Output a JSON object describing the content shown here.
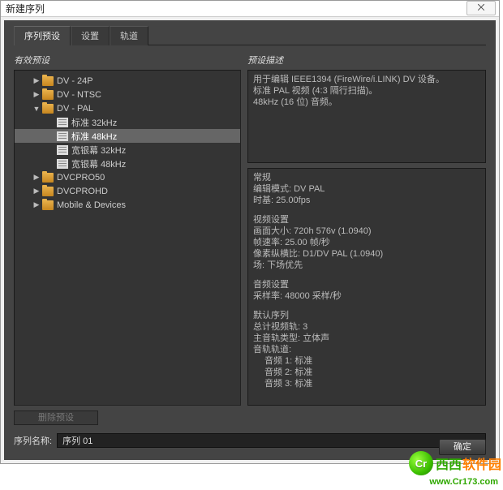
{
  "window": {
    "title": "新建序列",
    "close_glyph": "⨉"
  },
  "tabs": [
    "序列预设",
    "设置",
    "轨道"
  ],
  "active_tab_index": 0,
  "left": {
    "heading": "有效预设",
    "delete_label": "删除预设"
  },
  "tree": [
    {
      "name": "DV - 24P",
      "type": "folder",
      "indent": 1,
      "expanded": false
    },
    {
      "name": "DV - NTSC",
      "type": "folder",
      "indent": 1,
      "expanded": false
    },
    {
      "name": "DV - PAL",
      "type": "folder",
      "indent": 1,
      "expanded": true
    },
    {
      "name": "标准 32kHz",
      "type": "preset",
      "indent": 2
    },
    {
      "name": "标准 48kHz",
      "type": "preset",
      "indent": 2,
      "selected": true
    },
    {
      "name": "宽银幕 32kHz",
      "type": "preset",
      "indent": 2
    },
    {
      "name": "宽银幕 48kHz",
      "type": "preset",
      "indent": 2
    },
    {
      "name": "DVCPRO50",
      "type": "folder",
      "indent": 1,
      "expanded": false
    },
    {
      "name": "DVCPROHD",
      "type": "folder",
      "indent": 1,
      "expanded": false
    },
    {
      "name": "Mobile & Devices",
      "type": "folder",
      "indent": 1,
      "expanded": false
    }
  ],
  "right": {
    "heading": "预设描述",
    "desc": [
      "用于编辑 IEEE1394 (FireWire/i.LINK) DV 设备。",
      "标准 PAL 视频 (4:3 隔行扫描)。",
      "48kHz (16 位) 音频。"
    ],
    "spec": {
      "general_h": "常规",
      "general": [
        "编辑模式: DV PAL",
        "时基: 25.00fps"
      ],
      "video_h": "视频设置",
      "video": [
        "画面大小: 720h 576v (1.0940)",
        "帧速率: 25.00 帧/秒",
        "像素纵横比: D1/DV PAL (1.0940)",
        "场: 下场优先"
      ],
      "audio_h": "音频设置",
      "audio": [
        "采样率: 48000 采样/秒"
      ],
      "seq_h": "默认序列",
      "seq": [
        "总计视频轨: 3",
        "主音轨类型: 立体声",
        "音轨轨道:",
        "音频 1: 标准",
        "音频 2: 标准",
        "音频 3: 标准"
      ]
    }
  },
  "footer": {
    "label": "序列名称:",
    "value": "序列 01"
  },
  "buttons": {
    "ok": "确定"
  },
  "watermark": {
    "logo": "Cr",
    "cn": "西西",
    "net": "软件园",
    "url": "www.Cr173.com"
  }
}
